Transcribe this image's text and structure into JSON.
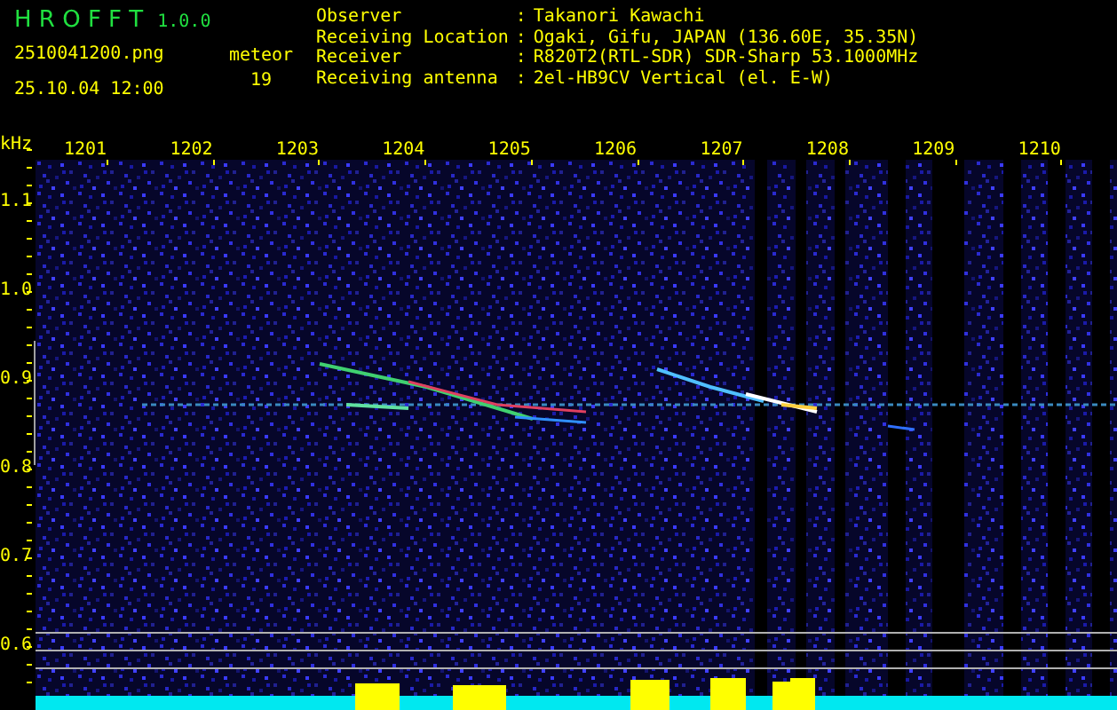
{
  "app": {
    "name": "H R O F F T",
    "version": "1.0.0"
  },
  "file_name": "2510041200.png",
  "timestamp": "25.10.04 12:00",
  "meteor": {
    "label": "meteor",
    "count": "19"
  },
  "station": [
    {
      "label": "Observer",
      "separator": ":",
      "value": "Takanori Kawachi"
    },
    {
      "label": "Receiving Location",
      "separator": ":",
      "value": "Ogaki, Gifu, JAPAN (136.60E, 35.35N)"
    },
    {
      "label": "Receiver",
      "separator": ":",
      "value": "R820T2(RTL-SDR) SDR-Sharp 53.1000MHz"
    },
    {
      "label": "Receiving antenna",
      "separator": ":",
      "value": "2el-HB9CV Vertical (el. E-W)"
    }
  ],
  "x_axis": {
    "unit": "kHz",
    "labels": [
      "1201",
      "1202",
      "1203",
      "1204",
      "1205",
      "1206",
      "1207",
      "1208",
      "1209",
      "1210"
    ]
  },
  "y_axis": {
    "labels": [
      "1.1",
      "1.0",
      "0.9",
      "0.8",
      "0.7",
      "0.6"
    ]
  }
}
